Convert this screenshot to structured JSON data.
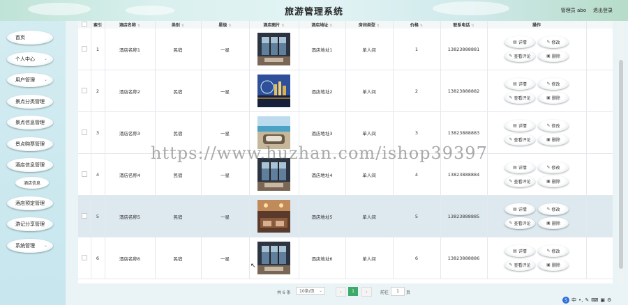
{
  "header": {
    "title": "旅游管理系统",
    "admin": "管理员 abo",
    "logout": "退出登录"
  },
  "sidebar": {
    "items": [
      {
        "label": "首页",
        "chevron": false
      },
      {
        "label": "个人中心",
        "chevron": true
      },
      {
        "label": "用户管理",
        "chevron": true
      },
      {
        "label": "景点分类管理",
        "chevron": false
      },
      {
        "label": "景点信息管理",
        "chevron": false
      },
      {
        "label": "景点购票管理",
        "chevron": false
      },
      {
        "label": "酒店信息管理",
        "chevron": false
      },
      {
        "label": "酒店预定管理",
        "chevron": false
      },
      {
        "label": "游记分享管理",
        "chevron": false
      },
      {
        "label": "系统管理",
        "chevron": true
      }
    ],
    "sub_item": "酒店信息"
  },
  "table": {
    "headers": [
      "索引",
      "酒店名称",
      "类别",
      "星级",
      "酒店图片",
      "酒店地址",
      "房间类型",
      "价格",
      "联系电话",
      "操作"
    ],
    "rows": [
      {
        "index": "1",
        "name": "酒店名称1",
        "category": "民宿",
        "star": "一星",
        "address": "酒店地址1",
        "room": "单人间",
        "price": "1",
        "phone": "13823888881",
        "img": "room"
      },
      {
        "index": "2",
        "name": "酒店名称2",
        "category": "民宿",
        "star": "一星",
        "address": "酒店地址2",
        "room": "单人间",
        "price": "2",
        "phone": "13823888882",
        "img": "city"
      },
      {
        "index": "3",
        "name": "酒店名称3",
        "category": "民宿",
        "star": "一星",
        "address": "酒店地址3",
        "room": "单人间",
        "price": "3",
        "phone": "13823888883",
        "img": "pool"
      },
      {
        "index": "4",
        "name": "酒店名称4",
        "category": "民宿",
        "star": "一星",
        "address": "酒店地址4",
        "room": "单人间",
        "price": "4",
        "phone": "13823888884",
        "img": "room"
      },
      {
        "index": "5",
        "name": "酒店名称5",
        "category": "民宿",
        "star": "一星",
        "address": "酒店地址5",
        "room": "单人间",
        "price": "5",
        "phone": "13823888885",
        "img": "lobby"
      },
      {
        "index": "6",
        "name": "酒店名称6",
        "category": "民宿",
        "star": "一星",
        "address": "酒店地址6",
        "room": "单人间",
        "price": "6",
        "phone": "13823888886",
        "img": "room"
      }
    ],
    "actions": {
      "detail": "详情",
      "edit": "修改",
      "review": "查看评论",
      "delete": "删除"
    },
    "highlight_row": 5
  },
  "pager": {
    "total": "共 6 条",
    "page_size": "10条/页",
    "current": "1",
    "goto": "前往",
    "goto_value": "1",
    "page_unit": "页"
  },
  "watermark": "https://www.huzhan.com/ishop39397",
  "tray": {
    "label": "中"
  },
  "colors": {
    "accent": "#3daa6a",
    "highlight": "#dde9ee"
  }
}
